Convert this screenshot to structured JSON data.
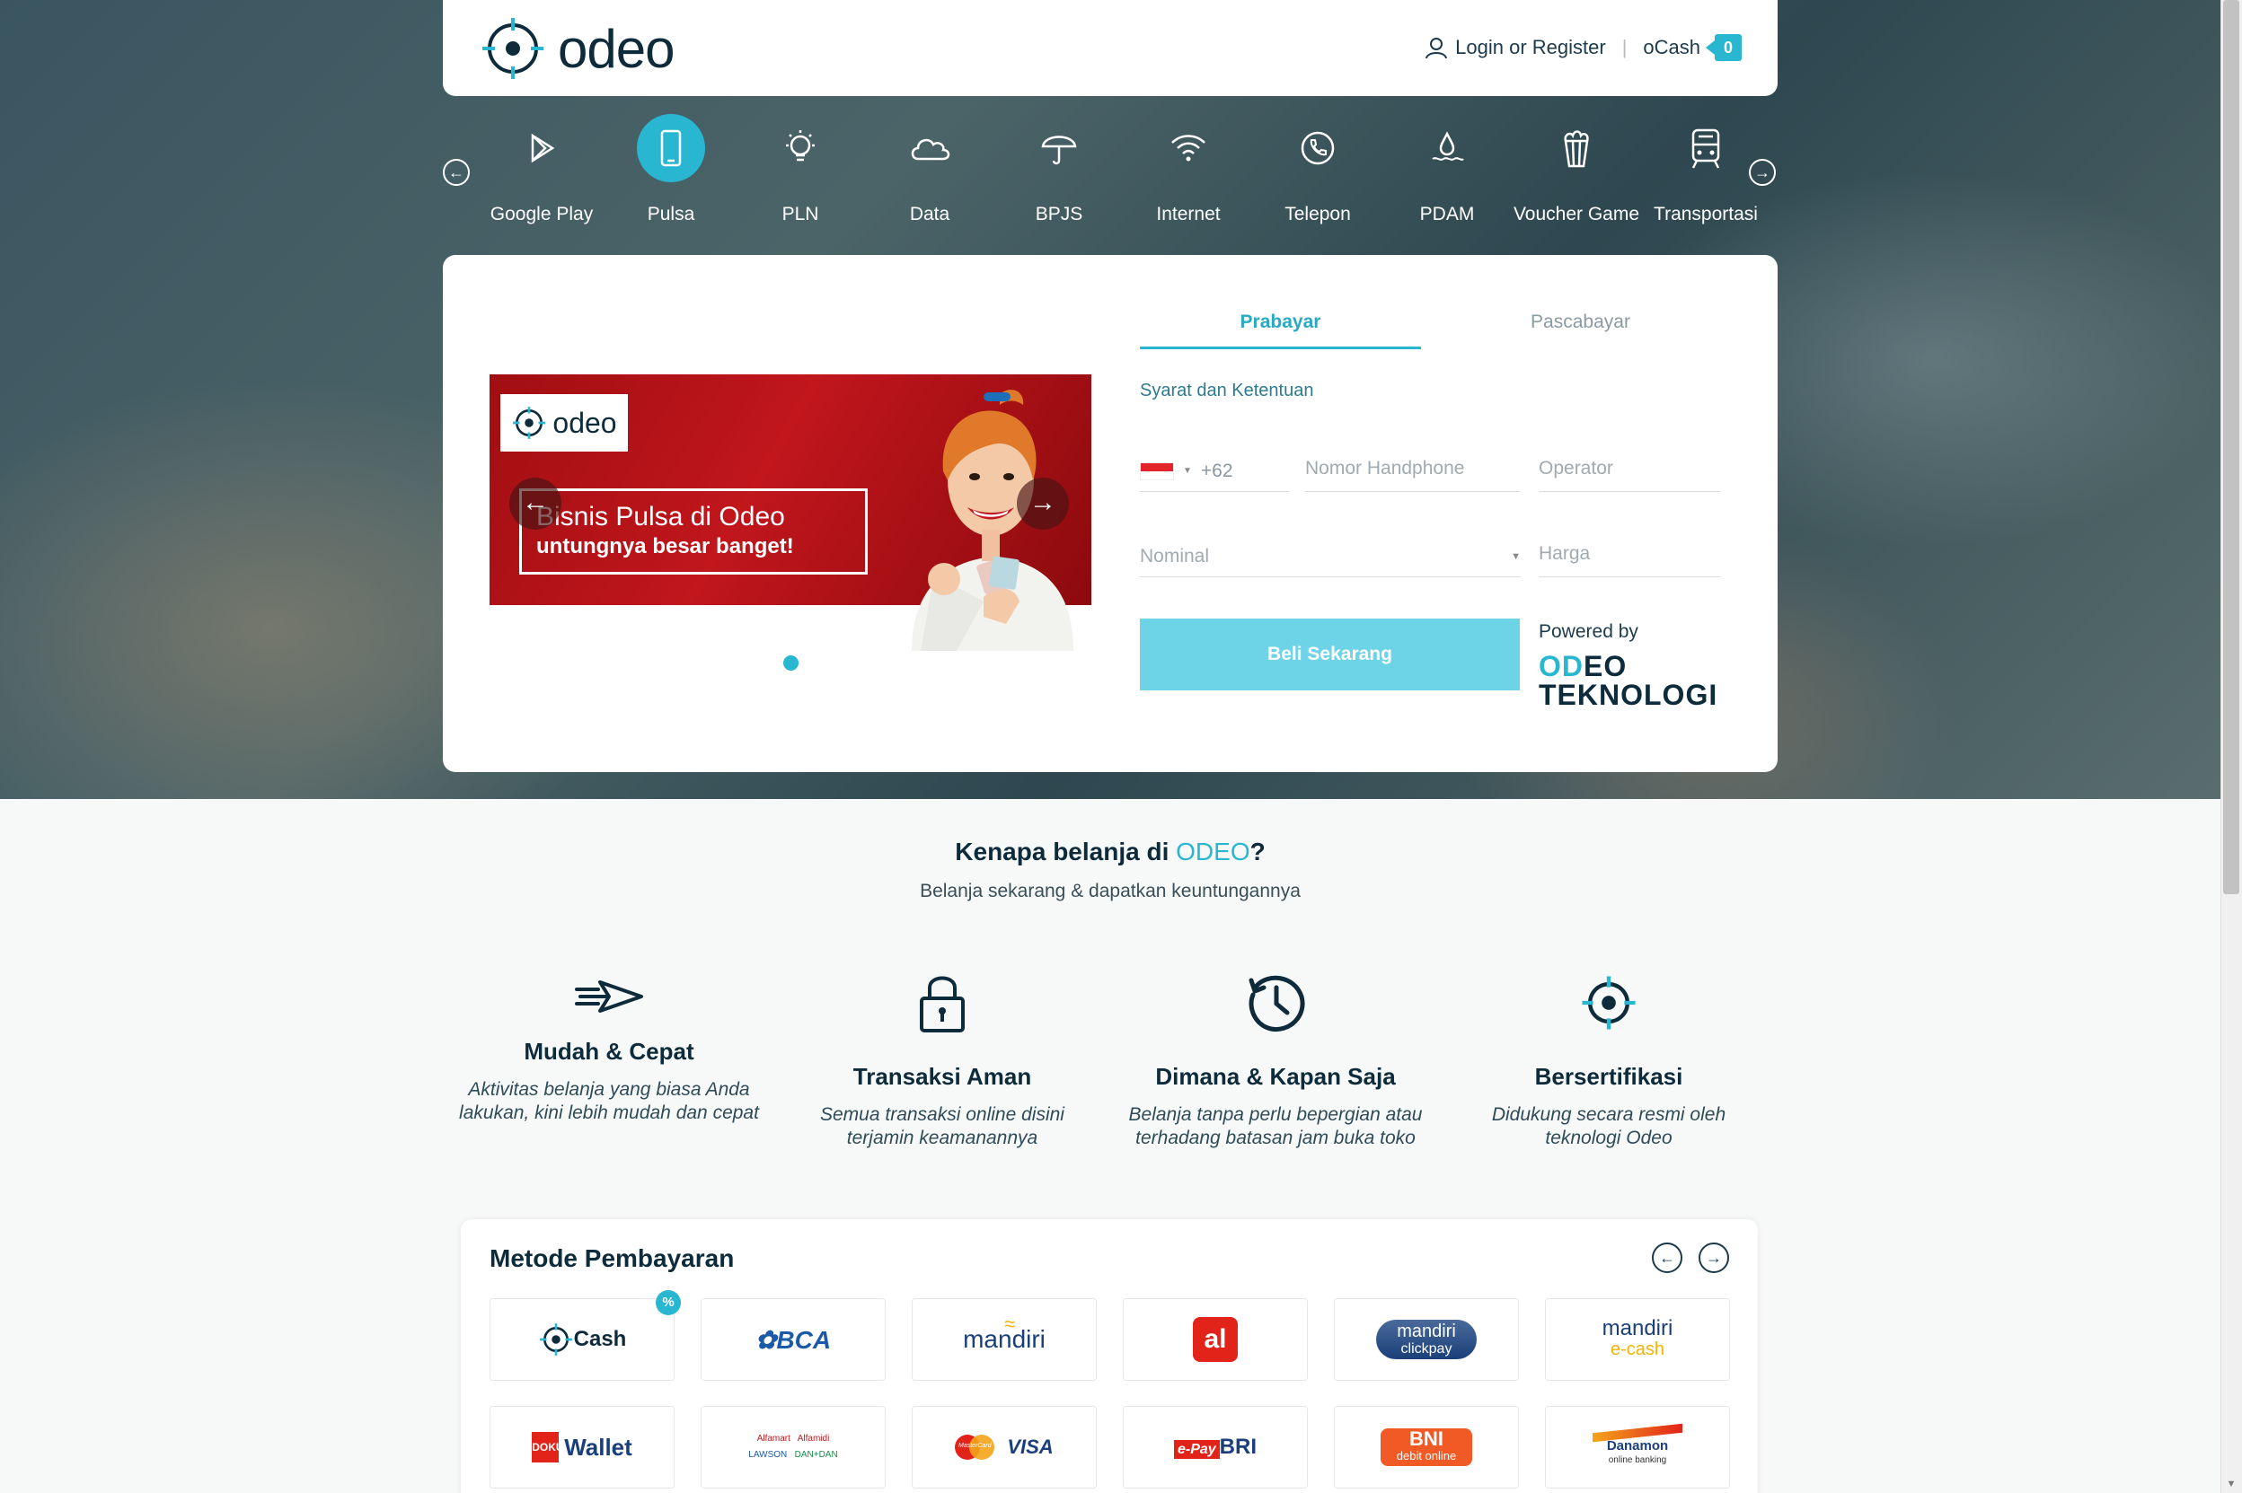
{
  "header": {
    "logo_text": "odeo",
    "login_label": "Login or Register",
    "ocash_label": "oCash",
    "ocash_count": "0"
  },
  "categories": [
    {
      "label": "Google Play",
      "icon": "google-play-icon"
    },
    {
      "label": "Pulsa",
      "icon": "phone-icon",
      "active": true
    },
    {
      "label": "PLN",
      "icon": "lightbulb-icon"
    },
    {
      "label": "Data",
      "icon": "cloud-icon"
    },
    {
      "label": "BPJS",
      "icon": "umbrella-icon"
    },
    {
      "label": "Internet",
      "icon": "wifi-icon"
    },
    {
      "label": "Telepon",
      "icon": "telephone-icon"
    },
    {
      "label": "PDAM",
      "icon": "water-drop-icon"
    },
    {
      "label": "Voucher Game",
      "icon": "popcorn-icon"
    },
    {
      "label": "Transportasi",
      "icon": "train-icon"
    }
  ],
  "banner": {
    "logo_text": "odeo",
    "line1": "Bisnis Pulsa di Odeo",
    "line2": "untungnya besar banget!"
  },
  "form": {
    "tabs": [
      "Prabayar",
      "Pascabayar"
    ],
    "active_tab": "Prabayar",
    "terms_link": "Syarat dan Ketentuan",
    "country_code": "+62",
    "phone_placeholder": "Nomor Handphone",
    "operator_placeholder": "Operator",
    "nominal_placeholder": "Nominal",
    "price_placeholder": "Harga",
    "buy_button": "Beli Sekarang",
    "powered_label": "Powered by",
    "powered_brand_a": "OD",
    "powered_brand_b": "EO",
    "powered_brand_line2": "TEKNOLOGI"
  },
  "why": {
    "title_prefix": "Kenapa belanja di ",
    "title_brand": "ODEO",
    "title_suffix": "?",
    "subtitle": "Belanja sekarang & dapatkan keuntungannya",
    "features": [
      {
        "title": "Mudah & Cepat",
        "desc": "Aktivitas belanja yang biasa Anda lakukan, kini lebih mudah dan cepat",
        "icon": "paper-plane-icon"
      },
      {
        "title": "Transaksi Aman",
        "desc": "Semua transaksi online disini terjamin keamanannya",
        "icon": "padlock-icon"
      },
      {
        "title": "Dimana & Kapan Saja",
        "desc": "Belanja tanpa perlu bepergian atau terhadang batasan jam buka toko",
        "icon": "clock-icon"
      },
      {
        "title": "Bersertifikasi",
        "desc": "Didukung secara resmi oleh teknologi Odeo",
        "icon": "odeo-target-icon"
      }
    ]
  },
  "payment": {
    "title": "Metode Pembayaran",
    "row1": [
      "Cash",
      "BCA",
      "mandiri",
      "al",
      "mandiri clickpay",
      "mandiri e-cash"
    ],
    "row2": [
      "Wallet",
      "Alfamart Alfamidi LAWSON DAN+DAN",
      "VISA",
      "e-Pay BRI",
      "BNI debit online",
      "Danamon online banking"
    ],
    "mandiri_clickpay_a": "mandiri",
    "mandiri_clickpay_b": "clickpay",
    "mandiri_ecash_a": "mandiri",
    "mandiri_ecash_b": "e-cash",
    "doku_logo": "DOKU",
    "mastercard_logo": "MasterCard",
    "alfamart_logo": "Alfamart",
    "alfamidi_logo": "Alfamidi",
    "lawson_logo": "LAWSON",
    "dandan_logo": "DAN+DAN",
    "epay_a": "e-Pay",
    "epay_b": "BRI",
    "bni_a": "BNI",
    "bni_b": "debit online",
    "danamon_a": "Danamon",
    "danamon_b": "online banking",
    "promo_badge": "%"
  },
  "colors": {
    "accent": "#29b6d1",
    "dark": "#0d2b3a",
    "button": "#6dd3e6"
  }
}
